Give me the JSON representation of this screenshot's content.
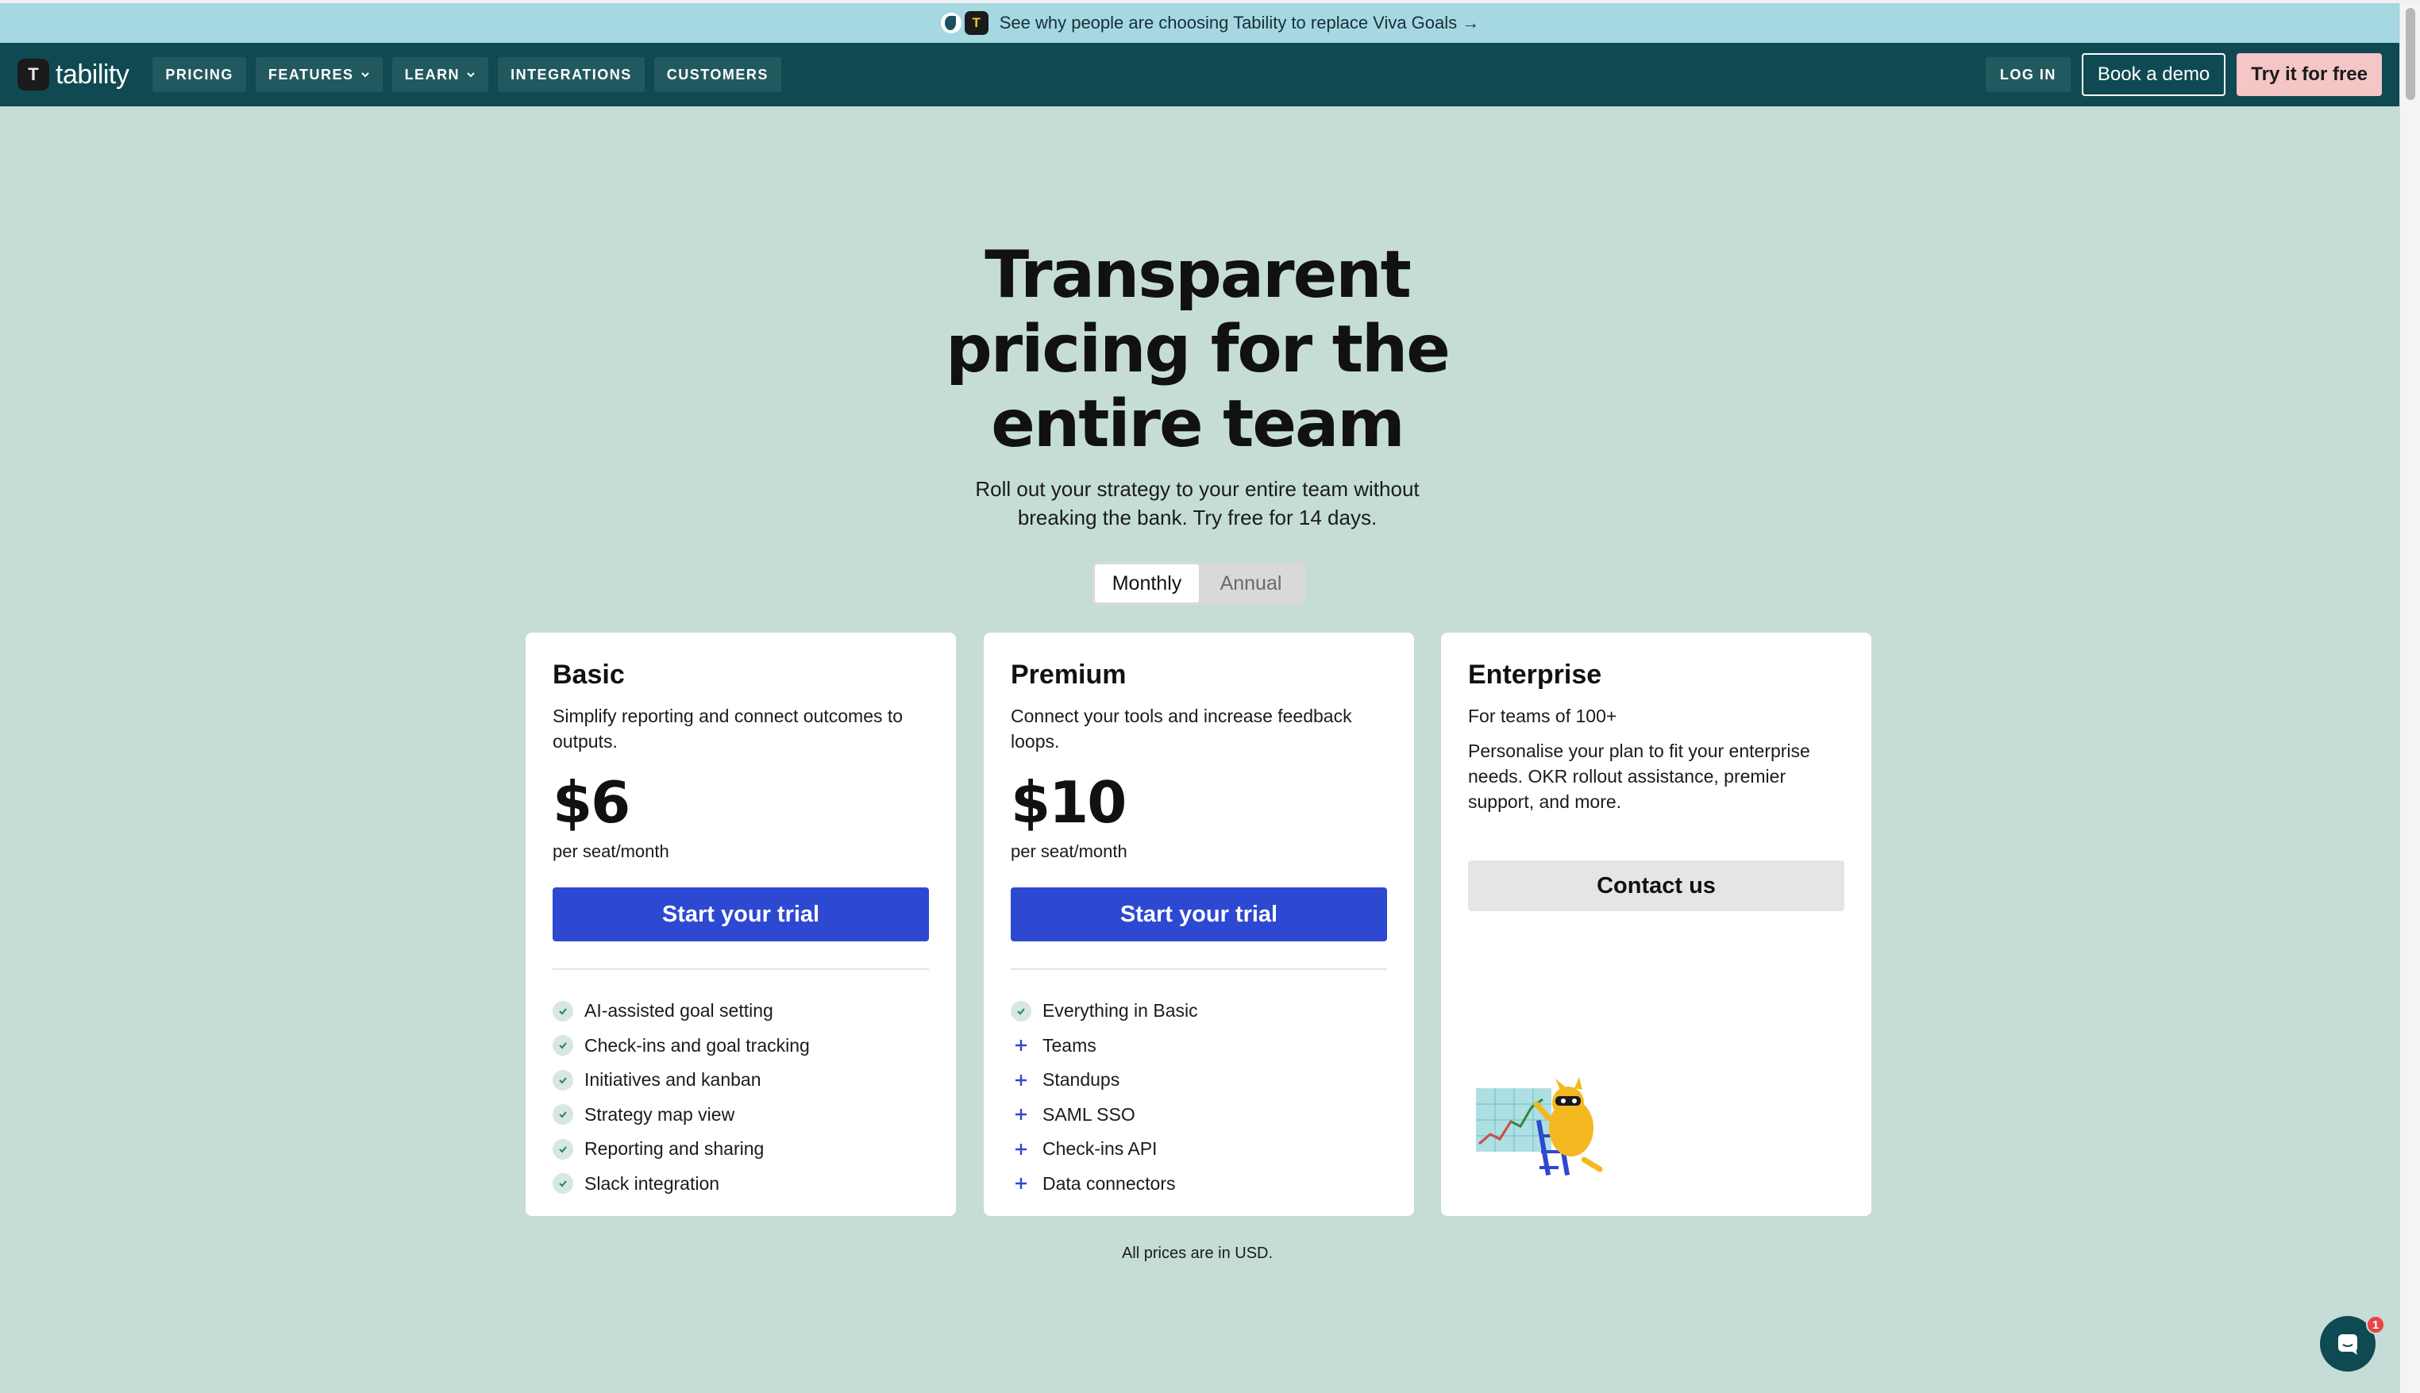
{
  "announcement": {
    "text": "See why people are choosing Tability to replace Viva Goals →"
  },
  "nav": {
    "brand": "tability",
    "links": [
      {
        "label": "PRICING",
        "dropdown": false
      },
      {
        "label": "FEATURES",
        "dropdown": true
      },
      {
        "label": "LEARN",
        "dropdown": true
      },
      {
        "label": "INTEGRATIONS",
        "dropdown": false
      },
      {
        "label": "CUSTOMERS",
        "dropdown": false
      }
    ],
    "login": "LOG IN",
    "book_demo": "Book a demo",
    "try_free": "Try it for free"
  },
  "hero": {
    "title_lines": [
      "Transparent",
      "pricing for the",
      "entire team"
    ],
    "subtitle_lines": [
      "Roll out your strategy to your entire team without",
      "breaking the bank. Try free for 14 days."
    ]
  },
  "billing_toggle": {
    "options": [
      "Monthly",
      "Annual"
    ],
    "selected": "Monthly"
  },
  "plans": {
    "basic": {
      "name": "Basic",
      "description": "Simplify reporting and connect outcomes to outputs.",
      "price": "$6",
      "unit": "per seat/month",
      "cta": "Start your trial",
      "features": [
        "AI-assisted goal setting",
        "Check-ins and goal tracking",
        "Initiatives and kanban",
        "Strategy map view",
        "Reporting and sharing",
        "Slack integration"
      ]
    },
    "premium": {
      "name": "Premium",
      "description": "Connect your tools and increase feedback loops.",
      "price": "$10",
      "unit": "per seat/month",
      "cta": "Start your trial",
      "features": [
        "Everything in Basic",
        "Teams",
        "Standups",
        "SAML SSO",
        "Check-ins API",
        "Data connectors"
      ]
    },
    "enterprise": {
      "name": "Enterprise",
      "tagline": "For teams of 100+",
      "description": "Personalise your plan to fit your enterprise needs. OKR rollout assistance, premier support, and more.",
      "cta": "Contact us"
    }
  },
  "footnote": "All prices are in USD.",
  "chat": {
    "badge_count": "1"
  },
  "colors": {
    "page_bg": "#c5ddd6",
    "nav_bg": "#0f4a52",
    "announce_bg": "#a6d8e2",
    "primary_button": "#2d48d1",
    "try_button": "#f5c6c6"
  },
  "icons": {
    "check": "check-circle-icon",
    "plus": "plus-icon",
    "chevron": "chevron-down-icon",
    "chat": "chat-bubble-icon"
  }
}
